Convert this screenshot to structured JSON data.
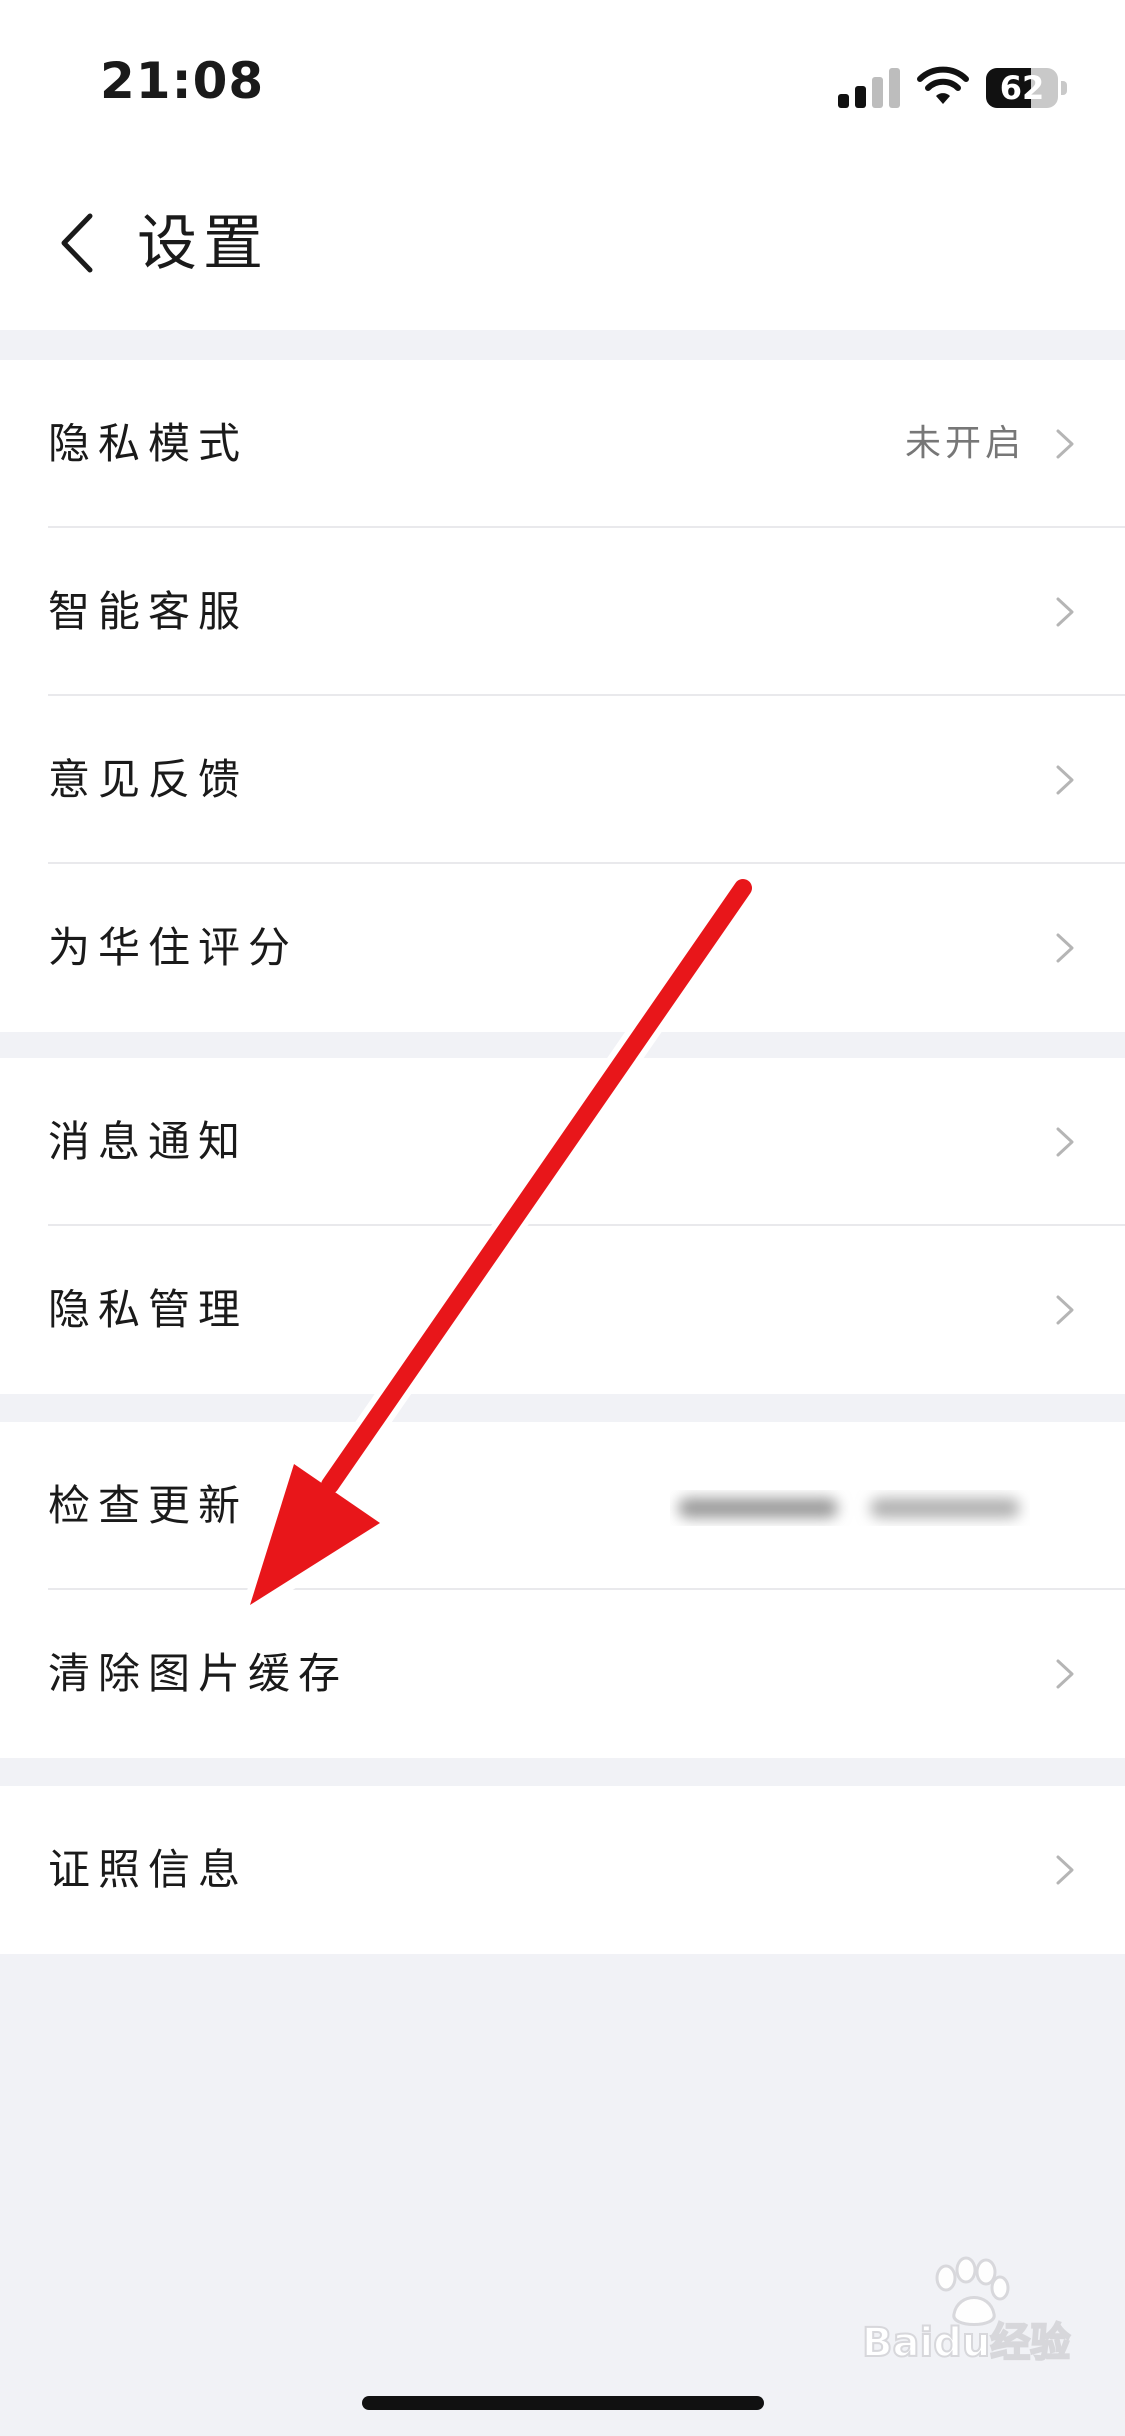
{
  "status_bar": {
    "time": "21:08",
    "battery_level": "62",
    "battery_fraction": 0.62
  },
  "nav": {
    "title": "设置",
    "back_icon": "chevron-left-icon"
  },
  "groups": [
    {
      "items": [
        {
          "label": "隐私模式",
          "value": "未开启"
        },
        {
          "label": "智能客服"
        },
        {
          "label": "意见反馈"
        },
        {
          "label": "为华住评分"
        }
      ]
    },
    {
      "items": [
        {
          "label": "消息通知"
        },
        {
          "label": "隐私管理"
        }
      ]
    },
    {
      "items": [
        {
          "label": "检查更新"
        },
        {
          "label": "清除图片缓存"
        }
      ]
    },
    {
      "items": [
        {
          "label": "证照信息"
        }
      ]
    }
  ],
  "annotation": {
    "color": "#e8161a",
    "target": "清除图片缓存"
  },
  "watermark": {
    "text": "Baidu经验",
    "icon": "baidu-paw-icon"
  },
  "colors": {
    "background": "#f1f2f6",
    "card": "#ffffff",
    "accent_arrow": "#e8161a"
  }
}
